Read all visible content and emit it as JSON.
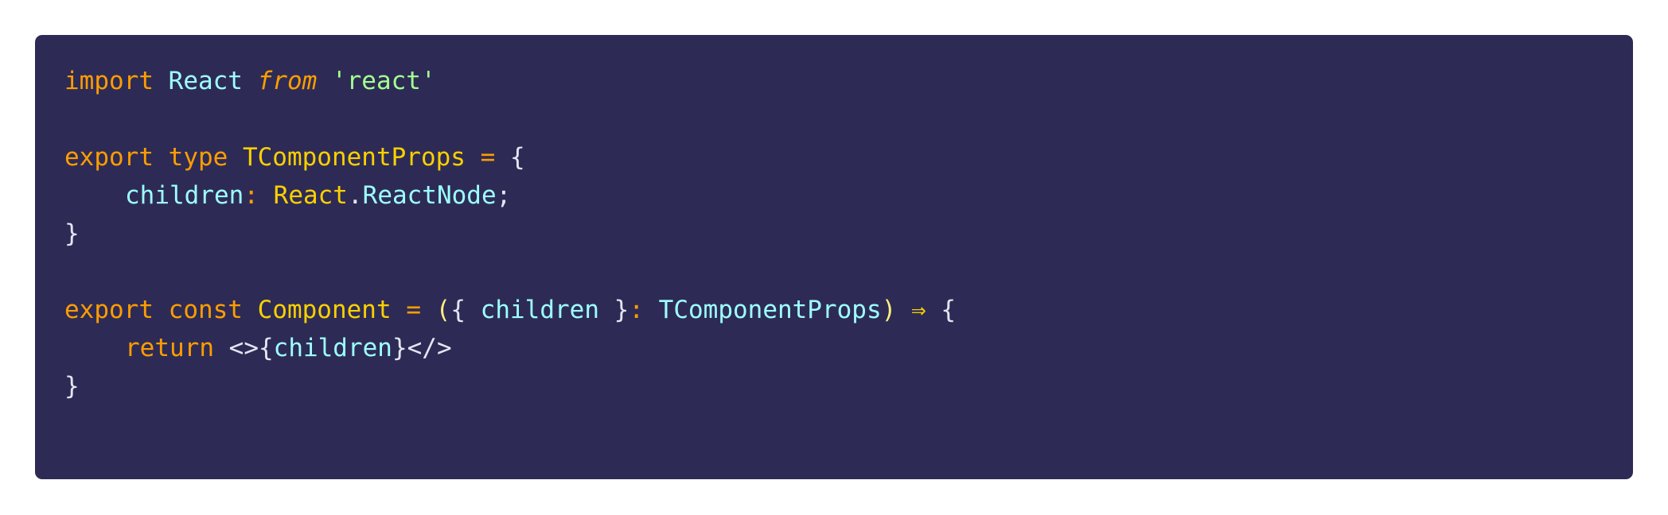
{
  "code_block": {
    "theme_colors": {
      "background": "#2d2b55",
      "keyword": "#ff9d00",
      "identifier": "#9effff",
      "type_name": "#fad000",
      "string": "#a5ff90",
      "punctuation": "#e3e6f2"
    },
    "lines": [
      {
        "tokens": {
          "t1": "import",
          "t2": "React",
          "t3": "from",
          "t4": "'react'"
        }
      },
      {
        "tokens": {}
      },
      {
        "tokens": {
          "t1": "export",
          "t2": "type",
          "t3": "TComponentProps",
          "t4": "=",
          "t5": "{"
        }
      },
      {
        "tokens": {
          "t1": "children",
          "t2": ":",
          "t3": "React",
          "t4": ".",
          "t5": "ReactNode",
          "t6": ";"
        }
      },
      {
        "tokens": {
          "t1": "}"
        }
      },
      {
        "tokens": {}
      },
      {
        "tokens": {
          "t1": "export",
          "t2": "const",
          "t3": "Component",
          "t4": "=",
          "t5": "(",
          "t6": "{",
          "t7": "children",
          "t8": "}",
          "t9": ":",
          "t10": "TComponentProps",
          "t11": ")",
          "t12": "⇒",
          "t13": "{"
        }
      },
      {
        "tokens": {
          "t1": "return",
          "t2": "<>",
          "t3": "{",
          "t4": "children",
          "t5": "}",
          "t6": "</>"
        }
      },
      {
        "tokens": {
          "t1": "}"
        }
      }
    ]
  }
}
